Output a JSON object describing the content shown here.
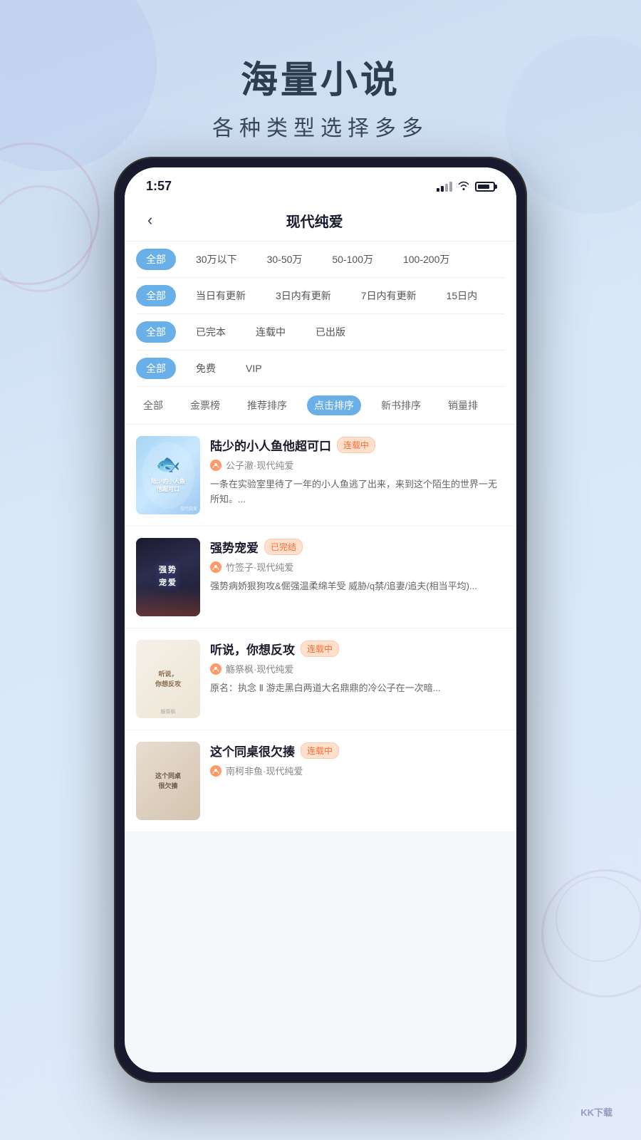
{
  "background": {
    "gradient_start": "#c8d8f0",
    "gradient_end": "#e0eaf8"
  },
  "header": {
    "title_main": "海量小说",
    "title_sub": "各种类型选择多多"
  },
  "status_bar": {
    "time": "1:57",
    "signal_label": "signal",
    "wifi_label": "wifi",
    "battery_label": "battery"
  },
  "navigation": {
    "back_icon": "‹",
    "title": "现代纯爱"
  },
  "filters": [
    {
      "label_active": "全部",
      "options": [
        "30万以下",
        "30-50万",
        "50-100万",
        "100-200万"
      ]
    },
    {
      "label_active": "全部",
      "options": [
        "当日有更新",
        "3日内有更新",
        "7日内有更新",
        "15日内"
      ]
    },
    {
      "label_active": "全部",
      "options": [
        "已完本",
        "连载中",
        "已出版"
      ]
    },
    {
      "label_active": "全部",
      "options": [
        "免费",
        "VIP"
      ]
    }
  ],
  "sort_tabs": {
    "items": [
      "全部",
      "金票榜",
      "推荐排序",
      "点击排序",
      "新书排序",
      "销量排"
    ],
    "active_index": 3
  },
  "books": [
    {
      "title": "陆少的小人鱼他超可口",
      "badge": "连载中",
      "badge_type": "ongoing",
      "author": "公子澈",
      "genre": "现代纯爱",
      "desc": "一条在实验室里待了一年的小人鱼逃了出来，来到这个陌生的世界一无所知。...",
      "cover_type": "1"
    },
    {
      "title": "强势宠爱",
      "badge": "已完结",
      "badge_type": "complete",
      "author": "竹签子",
      "genre": "现代纯爱",
      "desc": "强势病娇狠狗攻&倔强温柔绵羊受 威胁/q禁/追妻/追夫(相当平均)...",
      "cover_type": "2"
    },
    {
      "title": "听说，你想反攻",
      "badge": "连载中",
      "badge_type": "ongoing",
      "author": "觞祭枫",
      "genre": "现代纯爱",
      "desc": "原名：执念 Ⅱ 游走黑白两道大名鼎鼎的冷公子在一次暗...",
      "cover_type": "3"
    },
    {
      "title": "这个同桌很欠揍",
      "badge": "连载中",
      "badge_type": "ongoing",
      "author": "南柯非鱼",
      "genre": "现代纯爱",
      "desc": "",
      "cover_type": "4"
    }
  ],
  "watermark": "KK下载"
}
